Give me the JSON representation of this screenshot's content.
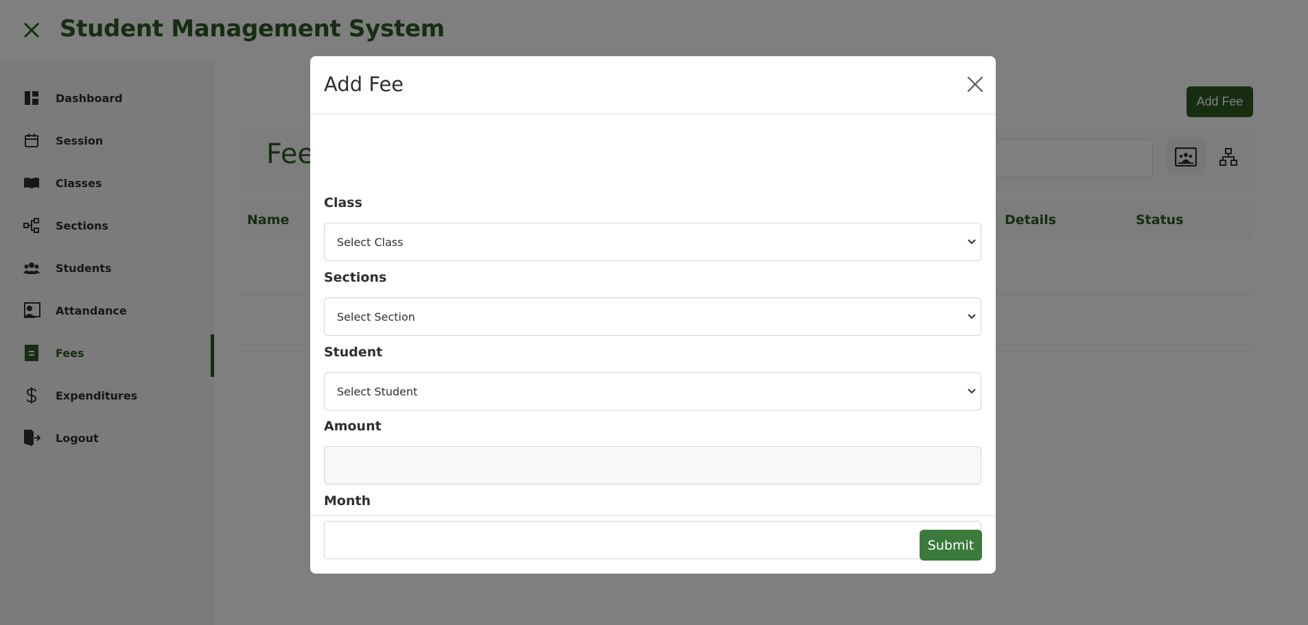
{
  "header": {
    "title": "Student Management System",
    "menu_icon": "close-icon"
  },
  "sidebar": {
    "items": [
      {
        "label": "Dashboard",
        "icon": "dashboard-icon"
      },
      {
        "label": "Session",
        "icon": "calendar-icon"
      },
      {
        "label": "Classes",
        "icon": "book-icon"
      },
      {
        "label": "Sections",
        "icon": "hierarchy-icon"
      },
      {
        "label": "Students",
        "icon": "people-icon"
      },
      {
        "label": "Attandance",
        "icon": "person-card-icon"
      },
      {
        "label": "Fees",
        "icon": "document-icon"
      },
      {
        "label": "Expenditures",
        "icon": "dollar-icon"
      },
      {
        "label": "Logout",
        "icon": "logout-icon"
      }
    ],
    "active": "Fees"
  },
  "main": {
    "add_button": "Add Fee",
    "card_title": "Fee",
    "table": {
      "headers": [
        "Name",
        "Details",
        "Status"
      ]
    }
  },
  "modal": {
    "title": "Add Fee",
    "fields": {
      "class": {
        "label": "Class",
        "value": "Select Class"
      },
      "sections": {
        "label": "Sections",
        "value": "Select Section"
      },
      "student": {
        "label": "Student",
        "value": "Select Student"
      },
      "amount": {
        "label": "Amount",
        "value": ""
      },
      "month": {
        "label": "Month",
        "value": ""
      }
    },
    "submit": "Submit"
  },
  "colors": {
    "brand": "#2c5a24",
    "submit": "#3a7a3a"
  }
}
